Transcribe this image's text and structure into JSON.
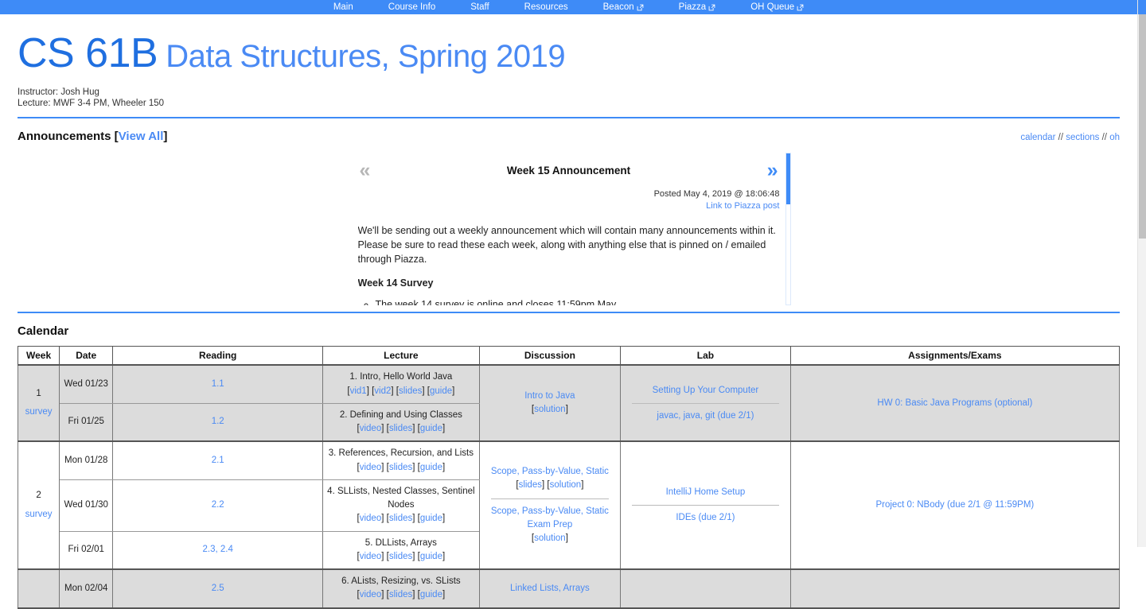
{
  "nav": {
    "items": [
      {
        "label": "Main",
        "external": false
      },
      {
        "label": "Course Info",
        "external": false
      },
      {
        "label": "Staff",
        "external": false
      },
      {
        "label": "Resources",
        "external": false
      },
      {
        "label": "Beacon",
        "external": true
      },
      {
        "label": "Piazza",
        "external": true
      },
      {
        "label": "OH Queue",
        "external": true
      }
    ]
  },
  "header": {
    "title_code": "CS 61B",
    "title_sub": "Data Structures, Spring 2019",
    "instructor": "Instructor: Josh Hug",
    "lecture": "Lecture: MWF 3-4 PM, Wheeler 150",
    "accent_color": "#3e8bf7",
    "link_color": "#4a8af4"
  },
  "announcements": {
    "heading": "Announcements [",
    "view_all": "View All",
    "heading_close": "]",
    "quick_links": {
      "calendar": "calendar",
      "sep1": " // ",
      "sections": "sections",
      "sep2": " // ",
      "oh": "oh"
    },
    "prev_icon": "«",
    "next_icon": "»",
    "title": "Week 15 Announcement",
    "posted": "Posted May 4, 2019 @ 18:06:48",
    "piazza_link": "Link to Piazza post",
    "paragraph": "We'll be sending out a weekly announcement which will contain many announcements within it. Please be sure to read these each week, along with anything else that is pinned on / emailed through Piazza.",
    "subheading": "Week 14 Survey",
    "bullets": [
      "The week 14 survey is online and closes 11:59pm May"
    ]
  },
  "calendar": {
    "title": "Calendar",
    "columns": [
      "Week",
      "Date",
      "Reading",
      "Lecture",
      "Discussion",
      "Lab",
      "Assignments/Exams"
    ],
    "weeks": [
      {
        "number": "1",
        "survey": "survey",
        "shaded": true,
        "rows": [
          {
            "date": "Wed 01/23",
            "reading": "1.1",
            "lecture_title": "1. Intro, Hello World Java",
            "lecture_links": [
              "vid1",
              "vid2",
              "slides",
              "guide"
            ]
          },
          {
            "date": "Fri 01/25",
            "reading": "1.2",
            "lecture_title": "2. Defining and Using Classes",
            "lecture_links": [
              "video",
              "slides",
              "guide"
            ]
          }
        ],
        "discussion": [
          {
            "title": "Intro to Java",
            "links": [
              "solution"
            ]
          }
        ],
        "lab": [
          {
            "title": "Setting Up Your Computer"
          },
          {
            "title": "javac, java, git (due 2/1)"
          }
        ],
        "assignments": [
          {
            "title": "HW 0: Basic Java Programs (optional)"
          }
        ]
      },
      {
        "number": "2",
        "survey": "survey",
        "shaded": false,
        "rows": [
          {
            "date": "Mon 01/28",
            "reading": "2.1",
            "lecture_title": "3. References, Recursion, and Lists",
            "lecture_links": [
              "video",
              "slides",
              "guide"
            ]
          },
          {
            "date": "Wed 01/30",
            "reading": "2.2",
            "lecture_title": "4. SLLists, Nested Classes, Sentinel Nodes",
            "lecture_links": [
              "video",
              "slides",
              "guide"
            ]
          },
          {
            "date": "Fri 02/01",
            "reading": "2.3, 2.4",
            "lecture_title": "5. DLLists, Arrays",
            "lecture_links": [
              "video",
              "slides",
              "guide"
            ]
          }
        ],
        "discussion": [
          {
            "title": "Scope, Pass-by-Value, Static",
            "links": [
              "slides",
              "solution"
            ]
          },
          {
            "title": "Scope, Pass-by-Value, Static Exam Prep",
            "links": [
              "solution"
            ]
          }
        ],
        "lab": [
          {
            "title": "IntelliJ Home Setup"
          },
          {
            "title": "IDEs (due 2/1)"
          }
        ],
        "assignments": [
          {
            "title": "Project 0: NBody (due 2/1 @ 11:59PM)"
          }
        ]
      },
      {
        "number": "",
        "survey": "",
        "shaded": true,
        "rows": [
          {
            "date": "Mon 02/04",
            "reading": "2.5",
            "lecture_title": "6. ALists, Resizing, vs. SLists",
            "lecture_links": [
              "video",
              "slides",
              "guide"
            ]
          }
        ],
        "discussion": [
          {
            "title": "Linked Lists, Arrays",
            "links": []
          }
        ],
        "lab": [],
        "assignments": []
      }
    ]
  }
}
